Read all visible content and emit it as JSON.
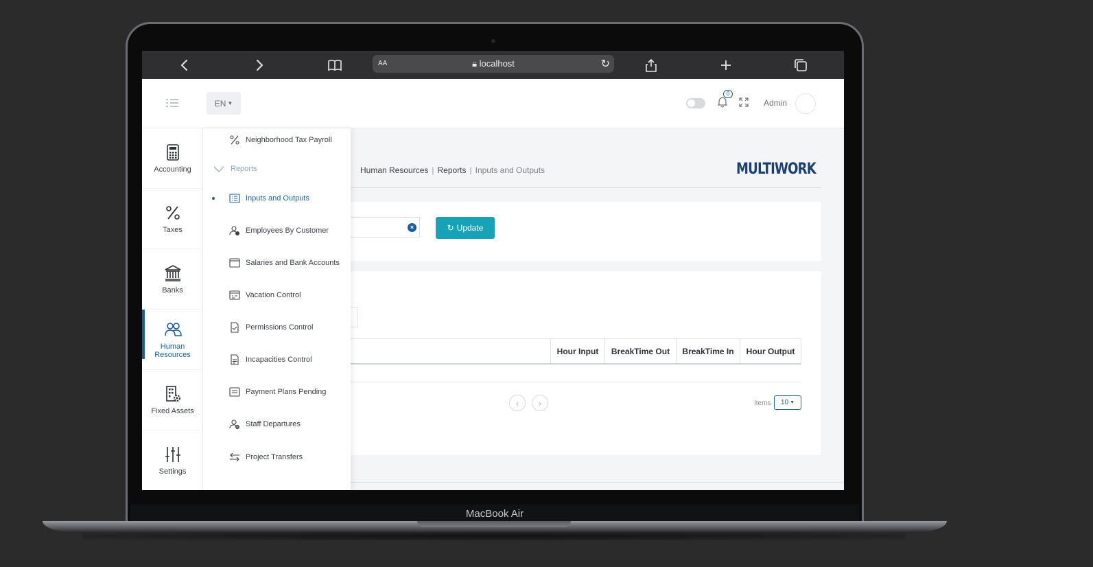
{
  "device": {
    "label": "MacBook Air"
  },
  "browser": {
    "url": "localhost",
    "text_size_label": "AA"
  },
  "header": {
    "language": "EN",
    "notification_count": "0",
    "user_name": "Admin"
  },
  "breadcrumb": {
    "items": [
      "Human Resources",
      "Reports"
    ],
    "current": "Inputs and Outputs"
  },
  "logo": {
    "text": "MULTIWORK",
    "color": "#1d3e71"
  },
  "filters": {
    "update_label": "Update",
    "accent": "#17a2b8"
  },
  "table": {
    "columns": [
      "Hour Input",
      "BreakTime Out",
      "BreakTime In",
      "Hour Output"
    ],
    "items_label": "Items",
    "page_size": "10"
  },
  "sidebar": {
    "active_color": "#1b5e9c",
    "items": [
      {
        "label": "Accounting",
        "icon": "calculator-icon"
      },
      {
        "label": "Taxes",
        "icon": "percent-icon"
      },
      {
        "label": "Banks",
        "icon": "bank-icon"
      },
      {
        "label": "Human Resources",
        "icon": "users-icon",
        "active": true
      },
      {
        "label": "Fixed Assets",
        "icon": "building-gear-icon"
      },
      {
        "label": "Settings",
        "icon": "sliders-icon"
      }
    ]
  },
  "submenu": {
    "top_item": "Neighborhood Tax Payroll",
    "section": "Reports",
    "items": [
      {
        "label": "Inputs and Outputs",
        "icon": "list-icon",
        "active": true
      },
      {
        "label": "Employees By Customer",
        "icon": "user-check-icon"
      },
      {
        "label": "Salaries and Bank Accounts",
        "icon": "card-icon"
      },
      {
        "label": "Vacation Control",
        "icon": "calendar-icon"
      },
      {
        "label": "Permissions Control",
        "icon": "file-check-icon"
      },
      {
        "label": "Incapacities Control",
        "icon": "file-text-icon"
      },
      {
        "label": "Payment Plans Pending",
        "icon": "receipt-icon"
      },
      {
        "label": "Staff Departures",
        "icon": "user-minus-icon"
      },
      {
        "label": "Project Transfers",
        "icon": "transfer-icon"
      }
    ]
  }
}
